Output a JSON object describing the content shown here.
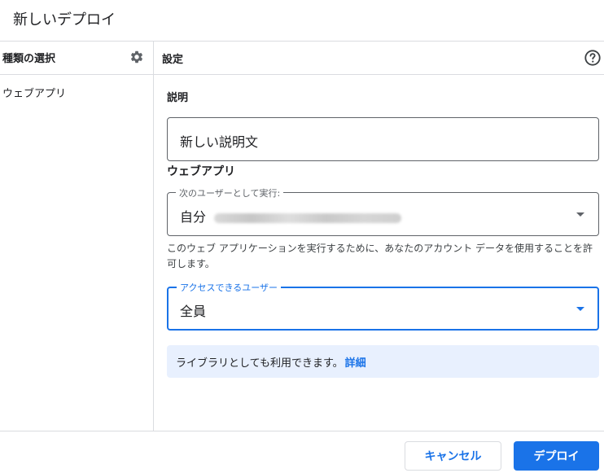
{
  "dialog": {
    "title": "新しいデプロイ"
  },
  "left_panel": {
    "header": "種類の選択",
    "settings_icon": "gear-icon",
    "items": [
      {
        "label": "ウェブアプリ"
      }
    ]
  },
  "right_panel": {
    "header": "設定",
    "help_icon": "help-circle-icon",
    "description": {
      "label": "説明",
      "value": "新しい説明文"
    },
    "web_app": {
      "section_label": "ウェブアプリ",
      "execute_as": {
        "label": "次のユーザーとして実行:",
        "value": "自分"
      },
      "helper_text": "このウェブ アプリケーションを実行するために、あなたのアカウント データを使用することを許可します。",
      "access": {
        "label": "アクセスできるユーザー",
        "value": "全員"
      }
    },
    "info": {
      "text": "ライブラリとしても利用できます。",
      "link": "詳細"
    }
  },
  "footer": {
    "cancel_label": "キャンセル",
    "deploy_label": "デプロイ"
  },
  "colors": {
    "accent": "#1a73e8",
    "info_background": "#e8f0fe",
    "border": "#dadce0"
  }
}
